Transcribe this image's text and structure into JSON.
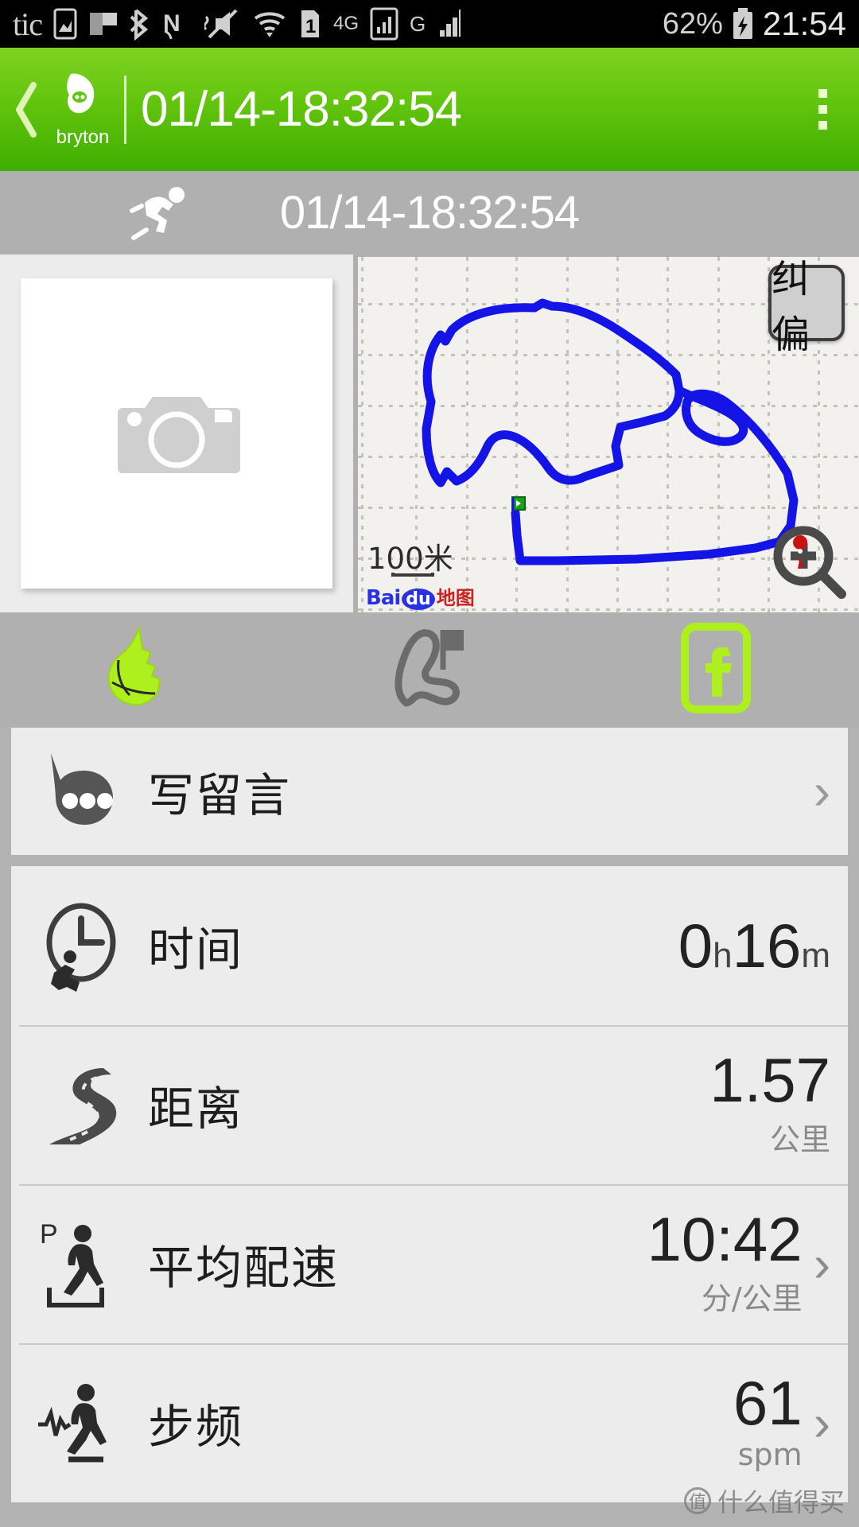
{
  "status_bar": {
    "left_label": "tic",
    "network_4g": "4G",
    "network_g": "G",
    "sim_badge": "1",
    "battery": "62%",
    "clock": "21:54",
    "icons": [
      "image-icon",
      "flag-icon",
      "bluetooth-icon",
      "nfc-icon",
      "mute-icon",
      "wifi-icon",
      "sim-icon",
      "signal-icon",
      "signal-icon-2",
      "battery-charging-icon"
    ]
  },
  "app_bar": {
    "back_label": "‹",
    "brand": "bryton",
    "title": "01/14-18:32:54",
    "overflow_label": "more-options"
  },
  "sub_bar": {
    "activity_icon": "running-icon",
    "title": "01/14-18:32:54"
  },
  "media": {
    "photo_placeholder_icon": "camera-icon",
    "map": {
      "correct_button": "纠偏",
      "scale_label": "100米",
      "provider_bai": "Bai",
      "provider_du": "du",
      "provider_map": "地图",
      "zoom_icon": "magnifier-plus-icon",
      "start_marker": "start-flag-marker",
      "track_color": "#1414e6"
    }
  },
  "tabs": [
    {
      "name": "shoe-tab",
      "icon": "running-shoe-icon",
      "active": true
    },
    {
      "name": "route-tab",
      "icon": "course-route-icon",
      "active": false
    },
    {
      "name": "facebook-tab",
      "icon": "facebook-icon",
      "active": true
    }
  ],
  "message_row": {
    "icon": "speech-bubble-icon",
    "label": "写留言",
    "chevron": "›"
  },
  "stats": [
    {
      "icon": "clock-runner-icon",
      "label": "时间",
      "value_hours": "0",
      "unit_hours": "h",
      "value_minutes": "16",
      "unit_minutes": "m",
      "sub_unit": "",
      "chevron": ""
    },
    {
      "icon": "winding-road-icon",
      "label": "距离",
      "value": "1.57",
      "sub_unit": "公里",
      "chevron": ""
    },
    {
      "icon": "pace-walker-icon",
      "label": "平均配速",
      "value": "10:42",
      "sub_unit": "分/公里",
      "chevron": "›"
    },
    {
      "icon": "cadence-runner-icon",
      "label": "步频",
      "value": "61",
      "sub_unit": "spm",
      "chevron": "›"
    }
  ],
  "watermark": {
    "mark": "值",
    "text": "什么值得买"
  },
  "colors": {
    "brand_green": "#62c40d",
    "accent_green": "#aef01e",
    "track_blue": "#1414e6",
    "bg_gray": "#b0b0b0",
    "card_gray": "#ececec"
  }
}
